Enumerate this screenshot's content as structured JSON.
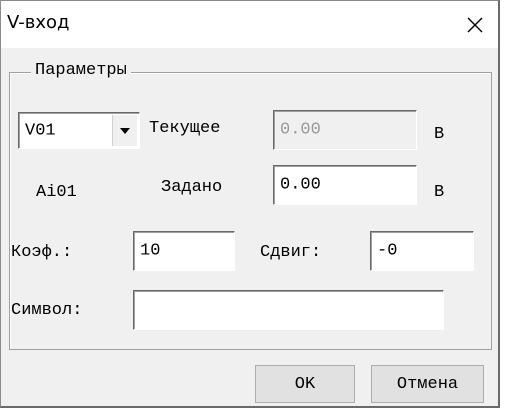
{
  "window": {
    "title": "V-вход",
    "close_icon": "close-icon"
  },
  "params": {
    "group_label": "Параметры",
    "channel_select": {
      "value": "V01",
      "icon": "chevron-down-icon"
    },
    "current_label": "Текущее",
    "current_value": "0.00",
    "current_unit": "В",
    "input_name": "Ai01",
    "setpoint_label": "Задано",
    "setpoint_value": "0.00",
    "setpoint_unit": "В",
    "coef_label": "Коэф.:",
    "coef_value": "10",
    "offset_label": "Сдвиг:",
    "offset_value": "-0",
    "symbol_label": "Символ:",
    "symbol_value": ""
  },
  "footer": {
    "ok_label": "OK",
    "cancel_label": "Отмена"
  }
}
